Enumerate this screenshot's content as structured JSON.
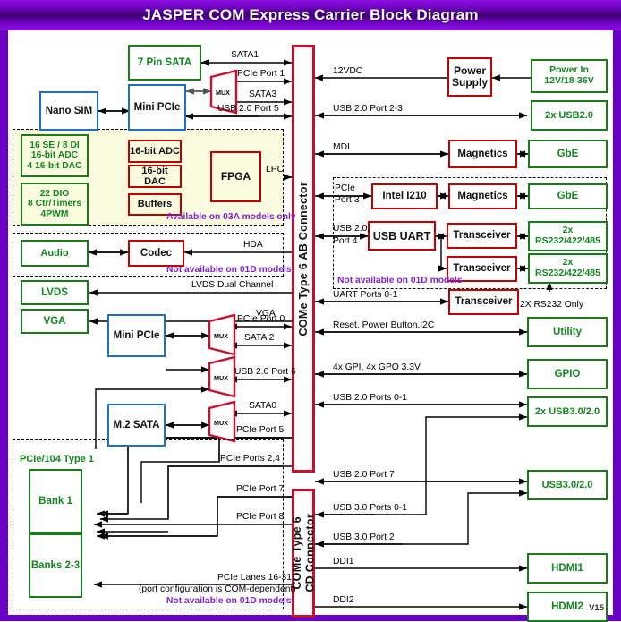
{
  "header": {
    "title": "JASPER COM Express Carrier Block Diagram"
  },
  "version": "V15",
  "colors": {
    "header_purple": "#6a00c8",
    "green_box": "#13861f",
    "blue_box": "#1f6fc4",
    "red_box": "#c00000",
    "connector_red": "#c8102e",
    "note_purple": "#7d26cd"
  },
  "connectors": [
    {
      "id": "ab",
      "label": "COMe Type 6 AB Connector"
    },
    {
      "id": "cd",
      "label": "COMe Type 6\nCD Connector"
    }
  ],
  "left_blocks": [
    {
      "name": "sata7pin",
      "label": "7 Pin SATA",
      "style": "g"
    },
    {
      "name": "nanosim",
      "label": "Nano SIM",
      "style": "b"
    },
    {
      "name": "minipcie1",
      "label": "Mini PCIe",
      "style": "b"
    },
    {
      "name": "analog-io",
      "label": "16 SE / 8 DI\n16-bit ADC\n4 16-bit DAC",
      "style": "g"
    },
    {
      "name": "digital-io",
      "label": "22 DIO\n8 Ctr/Timers\n4PWM",
      "style": "g"
    },
    {
      "name": "adc",
      "label": "16-bit ADC",
      "style": "r"
    },
    {
      "name": "dac",
      "label": "16-bit DAC",
      "style": "r"
    },
    {
      "name": "buffers",
      "label": "Buffers",
      "style": "r"
    },
    {
      "name": "fpga",
      "label": "FPGA",
      "style": "r"
    },
    {
      "name": "audio",
      "label": "Audio",
      "style": "g"
    },
    {
      "name": "codec",
      "label": "Codec",
      "style": "r"
    },
    {
      "name": "lvds",
      "label": "LVDS",
      "style": "g"
    },
    {
      "name": "vga",
      "label": "VGA",
      "style": "g"
    },
    {
      "name": "minipcie2",
      "label": "Mini PCIe",
      "style": "b"
    },
    {
      "name": "m2sata",
      "label": "M.2 SATA",
      "style": "b"
    },
    {
      "name": "bank1",
      "label": "Bank 1",
      "style": "g"
    },
    {
      "name": "banks23",
      "label": "Banks 2-3",
      "style": "g"
    }
  ],
  "right_blocks": [
    {
      "name": "power-supply",
      "label": "Power\nSupply",
      "style": "r"
    },
    {
      "name": "power-in",
      "label": "Power In\n12V/18-36V",
      "style": "g"
    },
    {
      "name": "usb20-2x",
      "label": "2x USB2.0",
      "style": "g"
    },
    {
      "name": "magnetics1",
      "label": "Magnetics",
      "style": "r"
    },
    {
      "name": "gbe1",
      "label": "GbE",
      "style": "g"
    },
    {
      "name": "intel-i210",
      "label": "Intel I210",
      "style": "r"
    },
    {
      "name": "magnetics2",
      "label": "Magnetics",
      "style": "r"
    },
    {
      "name": "gbe2",
      "label": "GbE",
      "style": "g"
    },
    {
      "name": "usb-uart",
      "label": "USB UART",
      "style": "r"
    },
    {
      "name": "transceiver1",
      "label": "Transceiver",
      "style": "r"
    },
    {
      "name": "rs232-a",
      "label": "2x\nRS232/422/485",
      "style": "g"
    },
    {
      "name": "transceiver2",
      "label": "Transceiver",
      "style": "r"
    },
    {
      "name": "rs232-b",
      "label": "2x\nRS232/422/485",
      "style": "g"
    },
    {
      "name": "transceiver3",
      "label": "Transceiver",
      "style": "r"
    },
    {
      "name": "utility",
      "label": "Utility",
      "style": "g"
    },
    {
      "name": "gpio",
      "label": "GPIO",
      "style": "g"
    },
    {
      "name": "usb3-2x",
      "label": "2x USB3.0/2.0",
      "style": "g"
    },
    {
      "name": "usb3-1x",
      "label": "USB3.0/2.0",
      "style": "g"
    },
    {
      "name": "hdmi1",
      "label": "HDMI1",
      "style": "g"
    },
    {
      "name": "hdmi2",
      "label": "HDMI2",
      "style": "g"
    }
  ],
  "mux_label": "MUX",
  "signal_labels": [
    {
      "name": "sig-sata1",
      "text": "SATA1"
    },
    {
      "name": "sig-pcie-port-1",
      "text": "PCIe Port 1"
    },
    {
      "name": "sig-sata3",
      "text": "SATA3"
    },
    {
      "name": "sig-usb20-port-5",
      "text": "USB 2.0 Port 5"
    },
    {
      "name": "sig-lpc",
      "text": "LPC"
    },
    {
      "name": "sig-hda",
      "text": "HDA"
    },
    {
      "name": "sig-lvds-dual",
      "text": "LVDS Dual Channel"
    },
    {
      "name": "sig-vga",
      "text": "VGA"
    },
    {
      "name": "sig-pcie-port-0",
      "text": "PCIe Port 0"
    },
    {
      "name": "sig-sata2",
      "text": "SATA 2"
    },
    {
      "name": "sig-usb20-port-6",
      "text": "USB 2.0 Port 6"
    },
    {
      "name": "sig-sata0",
      "text": "SATA0"
    },
    {
      "name": "sig-pcie-port-5",
      "text": "PCIe Port 5"
    },
    {
      "name": "sig-pcie-ports-24",
      "text": "PCIe Ports 2,4"
    },
    {
      "name": "sig-pcie-port-7",
      "text": "PCIe Port 7"
    },
    {
      "name": "sig-pcie-port-8",
      "text": "PCIe Port 8"
    },
    {
      "name": "sig-pcie-lanes",
      "text": "PCIe Lanes 16-31"
    },
    {
      "name": "sig-pcie-lanes-note",
      "text": "(port configuration is COM-dependent)"
    },
    {
      "name": "sig-12vdc",
      "text": "12VDC"
    },
    {
      "name": "sig-usb20-port-23",
      "text": "USB 2.0 Port 2-3"
    },
    {
      "name": "sig-mdi",
      "text": "MDI"
    },
    {
      "name": "sig-pcie",
      "text": "PCIe"
    },
    {
      "name": "sig-port-3",
      "text": "Port 3"
    },
    {
      "name": "sig-usb20",
      "text": "USB 2.0,"
    },
    {
      "name": "sig-port-4",
      "text": "Port 4"
    },
    {
      "name": "sig-uart-ports-01",
      "text": "UART Ports 0-1"
    },
    {
      "name": "sig-2x-rs232-only",
      "text": "2X RS232 Only"
    },
    {
      "name": "sig-reset-power",
      "text": "Reset, Power Button,I2C"
    },
    {
      "name": "sig-gpi-gpo",
      "text": "4x GPI, 4x GPO 3.3V"
    },
    {
      "name": "sig-usb20-ports-01",
      "text": "USB 2.0 Ports 0-1"
    },
    {
      "name": "sig-usb20-port-7",
      "text": "USB 2.0 Port 7"
    },
    {
      "name": "sig-usb30-ports-01",
      "text": "USB 3.0 Ports 0-1"
    },
    {
      "name": "sig-usb30-port-2",
      "text": "USB 3.0 Port 2"
    },
    {
      "name": "sig-ddi1",
      "text": "DDI1"
    },
    {
      "name": "sig-ddi2",
      "text": "DDI2"
    }
  ],
  "notes": [
    {
      "name": "note-03a",
      "text": "Available on 03A models only"
    },
    {
      "name": "note-01d-audio",
      "text": "Not available on 01D models"
    },
    {
      "name": "note-01d-serial",
      "text": "Not available on 01D models"
    },
    {
      "name": "note-01d-pcie104",
      "text": "Not available on 01D models"
    }
  ],
  "group_labels": [
    {
      "name": "group-pcie104",
      "text": "PCIe/104 Type 1"
    }
  ]
}
